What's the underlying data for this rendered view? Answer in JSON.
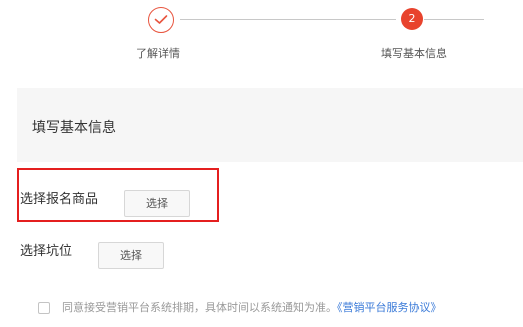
{
  "stepper": {
    "step1_label": "了解详情",
    "step2_number": "2",
    "step2_label": "填写基本信息"
  },
  "section": {
    "title": "填写基本信息"
  },
  "form": {
    "product_label": "选择报名商品",
    "product_button": "选择",
    "slot_label": "选择坑位",
    "slot_button": "选择"
  },
  "agreement": {
    "text": "同意接受营销平台系统排期，具体时间以系统通知为准。",
    "link": "《营销平台服务协议》"
  },
  "colors": {
    "accent": "#e8432d",
    "highlight_border": "#e41f1f",
    "link": "#3a7ad8"
  }
}
